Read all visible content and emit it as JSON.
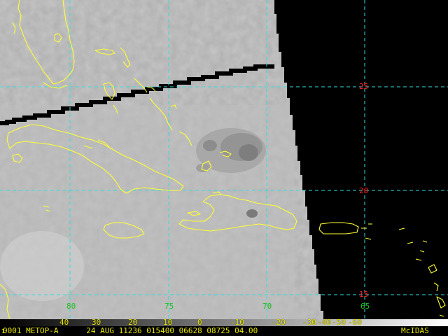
{
  "map": {
    "latitudes": [
      "25",
      "20",
      "15"
    ],
    "longitudes": [
      "80",
      "75",
      "70",
      "65"
    ],
    "colors": {
      "coast": "#ffff33",
      "grid": "#33dddd",
      "lat_label": "#ff2020",
      "lon_label": "#20c020",
      "missing_data": "#000000",
      "scan_gap": "#000000",
      "cloud_top": "#9a9a9a",
      "background": "#c4c4c4"
    }
  },
  "colorbar": {
    "ticks": [
      "40",
      "30",
      "20",
      "10",
      "0",
      "-10",
      "-20",
      "-30",
      "-40",
      "-50",
      "-60"
    ],
    "gradient": [
      "#000000",
      "#ffffff"
    ]
  },
  "status": {
    "frame": "1",
    "text": "0001 METOP-A      24 AUG 11236 015400 06628 08725 04.00",
    "brand": "McIDAS"
  }
}
